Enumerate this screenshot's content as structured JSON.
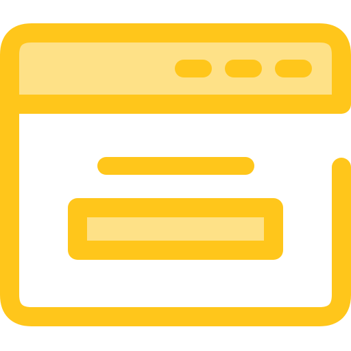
{
  "icon": {
    "name": "browser-window-icon",
    "colors": {
      "stroke": "#FFC61B",
      "fill_light": "#FEE187",
      "background": "#FFFFFF"
    },
    "title_bar": {
      "controls": [
        "window-control-dot",
        "window-control-dot",
        "window-control-dot"
      ]
    },
    "content": {
      "heading_line": "text-line",
      "input_box": "input-field"
    }
  }
}
